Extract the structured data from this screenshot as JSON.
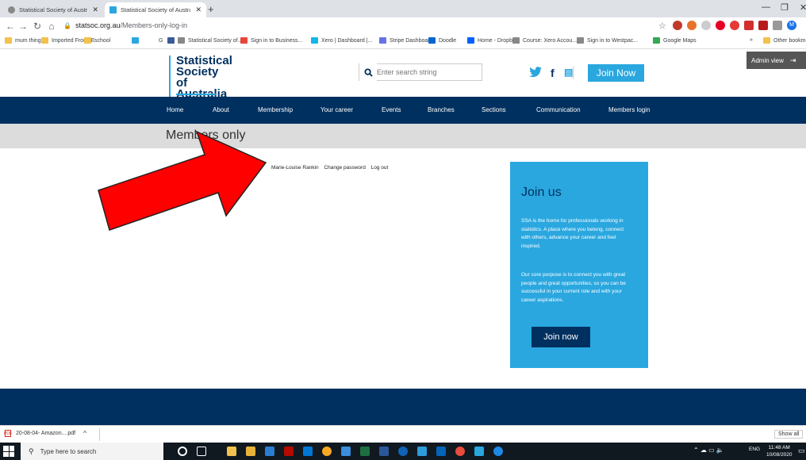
{
  "browser": {
    "tabs": [
      {
        "label": "Statistical Society of Australia - I",
        "active": false
      },
      {
        "label": "Statistical Society of Australia - M",
        "active": true
      }
    ],
    "new_tab_icon": "+",
    "address": {
      "domain": "statsoc.org.au",
      "path": "/Members-only-log-in"
    },
    "bookmarks": [
      {
        "label": "mum things",
        "color": "#f2c14e"
      },
      {
        "label": "Imported From IE",
        "color": "#f2c14e"
      },
      {
        "label": "school",
        "color": "#f2c14e"
      },
      {
        "label": "",
        "color": "#2aa7df"
      },
      {
        "label": "G",
        "color": "#ffffff"
      },
      {
        "label": "",
        "color": "#3b5998"
      },
      {
        "label": "Statistical Society of...",
        "color": "#888888"
      },
      {
        "label": "Sign in to Business...",
        "color": "#e8453c"
      },
      {
        "label": "Xero | Dashboard |...",
        "color": "#13b5ea"
      },
      {
        "label": "Stripe Dashboard",
        "color": "#6772e5"
      },
      {
        "label": "Doodle",
        "color": "#0066cc"
      },
      {
        "label": "Home - Dropbox",
        "color": "#0061ff"
      },
      {
        "label": "Course: Xero Accou...",
        "color": "#888888"
      },
      {
        "label": "Sign in to Westpac...",
        "color": "#888888"
      },
      {
        "label": "Google Maps",
        "color": "#34a853"
      }
    ],
    "bookmarks_overflow": "»",
    "other_bookmarks": "Other bookmarks"
  },
  "site": {
    "logo": {
      "line1": "Statistical",
      "line2": "Society of",
      "line3": "Australia"
    },
    "search_placeholder": "Enter search string",
    "social": {
      "twitter": "twitter-icon",
      "facebook": "facebook-icon",
      "chat": "chat-icon"
    },
    "join_button": "Join Now",
    "nav": [
      "Home",
      "About",
      "Membership",
      "Your career",
      "Events",
      "Branches",
      "Sections",
      "Communication",
      "Members login"
    ],
    "page_title": "Members only",
    "user_links": {
      "name": "Marie-Louise Rankin",
      "change_password": "Change password",
      "logout": "Log out"
    },
    "join_box": {
      "heading": "Join us",
      "p1": "SSA is the home for professionals working in statistics. A place where you belong, connect with others, advance your career and feel inspired.",
      "p2": "Our core purpose is to connect you with great people and great opportunities, so you can be successful in your current role and with your career aspirations.",
      "button": "Join now"
    },
    "admin_view": "Admin view"
  },
  "downloads": {
    "file": "20-08-04- Amazon....pdf",
    "show_all": "Show all"
  },
  "taskbar": {
    "search_placeholder": "Type here to search",
    "tray_lang": "ENG",
    "time": "11:48 AM",
    "date": "10/08/2020"
  },
  "colors": {
    "navy": "#00305f",
    "accent": "#2aa7df",
    "arrow": "#ff0000"
  }
}
